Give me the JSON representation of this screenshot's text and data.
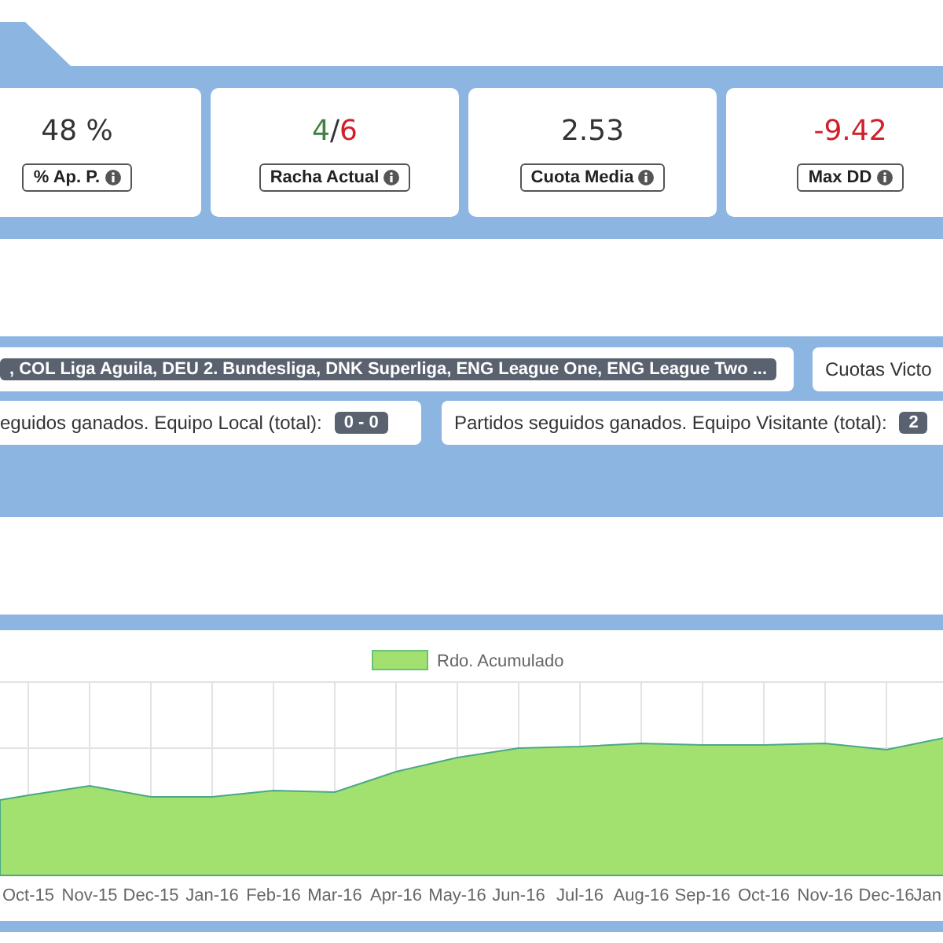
{
  "metrics": [
    {
      "value_parts": [
        {
          "text": "48 %",
          "color": "#333333"
        }
      ],
      "label": "% Ap. P."
    },
    {
      "value_parts": [
        {
          "text": "4",
          "color": "#3f7f3f"
        },
        {
          "text": "/",
          "color": "#333333"
        },
        {
          "text": "6",
          "color": "#d0212b"
        }
      ],
      "label": "Racha Actual"
    },
    {
      "value_parts": [
        {
          "text": "2.53",
          "color": "#333333"
        }
      ],
      "label": "Cuota Media"
    },
    {
      "value_parts": [
        {
          "text": "-9.42",
          "color": "#d0212b"
        }
      ],
      "label": "Max DD"
    }
  ],
  "filters": {
    "leagues_badge": ", COL Liga Aguila, DEU 2. Bundesliga, DNK Superliga, ENG League One, ENG League Two ...",
    "odds_label": "Cuotas Victo",
    "home_label": "eguidos ganados. Equipo Local (total):",
    "home_badge": "0 - 0",
    "away_label": "Partidos seguidos ganados. Equipo Visitante (total):",
    "away_badge": "2"
  },
  "chart": {
    "legend": "Rdo. Acumulado",
    "categories": [
      "Oct-15",
      "Nov-15",
      "Dec-15",
      "Jan-16",
      "Feb-16",
      "Mar-16",
      "Apr-16",
      "May-16",
      "Jun-16",
      "Jul-16",
      "Aug-16",
      "Sep-16",
      "Oct-16",
      "Nov-16",
      "Dec-16",
      "Jan"
    ]
  }
}
